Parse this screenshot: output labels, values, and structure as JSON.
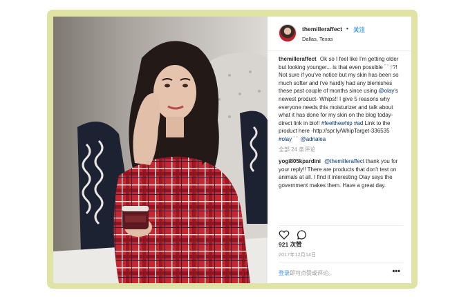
{
  "header": {
    "username": "themilleraffect",
    "dot": "•",
    "follow_label": "关注",
    "location": "Dallas, Texas"
  },
  "caption": {
    "username": "themilleraffect",
    "text_1": "Ok so I feel like I'm getting older but looking younger... is that even possible",
    "emoji_1": "ﾞﾟｸ",
    "text_2": "?! Not sure if you've notice but my skin has been so much softer and i've hardly had any blemishes these past couple of months since using",
    "mention_olay": "@olay",
    "text_3": "'s newest product- Whips!! I give 5 reasons why everyone needs this moisturizer and talk about what it has done for my skin on the blog today-direct link in bio!!",
    "hashtag_1": "#feelthewhip",
    "hashtag_2": "#ad",
    "text_4": "Link to the product here -http://spr.ly/WhipTarget-336535",
    "hashtag_3": "#olay",
    "emoji_2": "ﾞﾟ",
    "mention_adrialea": "@adrialea"
  },
  "view_all_comments": "全部 24 条评论",
  "comment": {
    "username": "yogi805kpardini",
    "mention": "@themilleraffect",
    "text": "thank you for your reply!! There are products that don't test on animals at all. I find it interesting Olay says the government makes them. Have a great day."
  },
  "likes": {
    "count": "921",
    "label": "次赞"
  },
  "date": "2017年12月14日",
  "add_comment": {
    "login_label": "登录",
    "rest": "即可点赞或评论。",
    "more_label": "•••"
  },
  "icons": {
    "like": "heart-icon",
    "comment": "speech-bubble-icon",
    "more": "more-options-icon"
  },
  "colors": {
    "frame": "#dfe4a4",
    "link_blue": "#3897f0",
    "plaid_red": "#c62630"
  }
}
